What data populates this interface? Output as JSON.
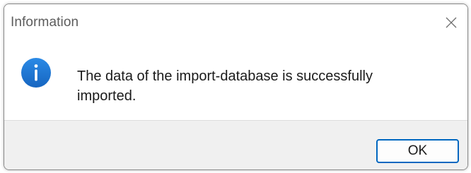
{
  "dialog": {
    "title": "Information",
    "close_icon": "close-icon",
    "icon": "info-icon",
    "message_line1": "The data of the import-database is successfully",
    "message_line2": "imported.",
    "ok_label": "OK"
  },
  "colors": {
    "accent": "#0067c0",
    "info_icon": "#1b74d1",
    "footer_bg": "#f0f0f0"
  }
}
